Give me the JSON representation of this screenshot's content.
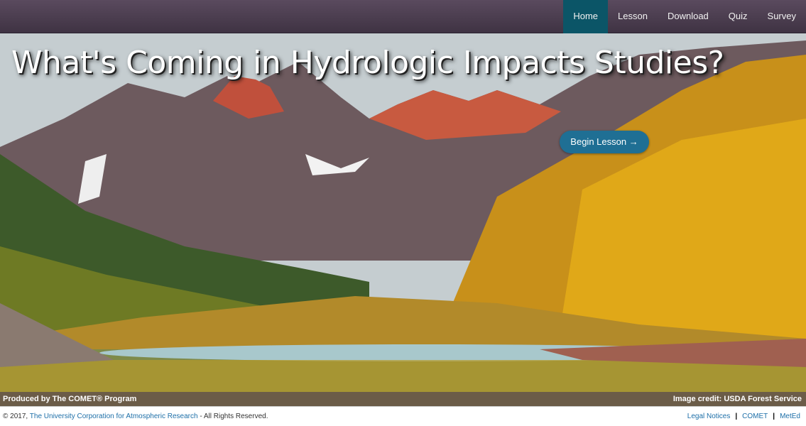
{
  "nav": {
    "items": [
      {
        "label": "Home",
        "active": true
      },
      {
        "label": "Lesson"
      },
      {
        "label": "Download"
      },
      {
        "label": "Quiz"
      },
      {
        "label": "Survey"
      }
    ]
  },
  "hero": {
    "title": "What's Coming in Hydrologic Impacts Studies?",
    "begin_button": "Begin Lesson →",
    "image_alt": "Maroon Bells mountains with autumn aspens reflected in a lake"
  },
  "credits": {
    "produced_by": "Produced by The COMET® Program",
    "image_credit": "Image credit: USDA Forest Service"
  },
  "footer": {
    "copyright_prefix": "© 2017, ",
    "org_link": "The University Corporation for Atmospheric Research",
    "copyright_suffix": " - All Rights Reserved.",
    "links": [
      "Legal Notices",
      "COMET",
      "MetEd"
    ]
  },
  "colors": {
    "nav_active": "#0b5567",
    "button": "#1f6f94",
    "credit_bar": "#6b5c48"
  }
}
